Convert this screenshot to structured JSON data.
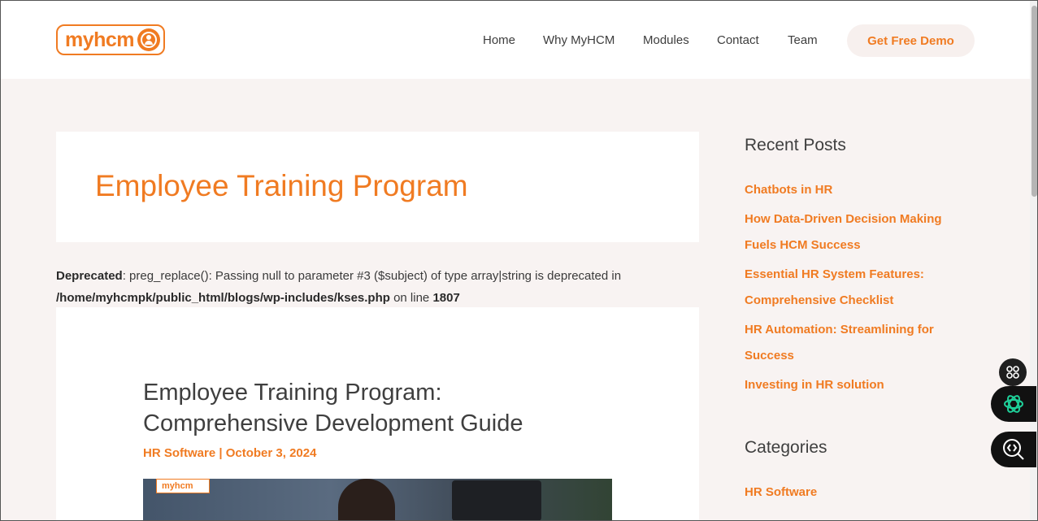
{
  "header": {
    "logo_text": "myhcm",
    "nav": [
      "Home",
      "Why MyHCM",
      "Modules",
      "Contact",
      "Team"
    ],
    "cta": "Get Free Demo"
  },
  "main": {
    "title": "Employee Training Program",
    "deprecated": {
      "label": "Deprecated",
      "message": ": preg_replace(): Passing null to parameter #3 ($subject) of type array|string is deprecated in",
      "path": "/home/myhcmpk/public_html/blogs/wp-includes/kses.php",
      "on_line": " on line ",
      "line": "1807"
    },
    "article": {
      "title": "Employee Training Program: Comprehensive Development Guide",
      "meta": "HR Software | October 3, 2024",
      "image_logo": "myhcm"
    }
  },
  "sidebar": {
    "recent_heading": "Recent Posts",
    "recent_posts": [
      "Chatbots in HR",
      "How Data-Driven Decision Making Fuels HCM Success",
      "Essential HR System Features: Comprehensive Checklist",
      "HR Automation: Streamlining for Success",
      "Investing in HR solution"
    ],
    "categories_heading": "Categories",
    "categories": [
      "HR Software"
    ]
  },
  "colors": {
    "accent": "#f07b22",
    "page_bg": "#f8f3f2"
  },
  "icons": {
    "logo": "user-circle-icon",
    "fab_small": "apps-grid-icon",
    "fab_1": "openai-icon",
    "fab_2": "code-search-icon"
  }
}
